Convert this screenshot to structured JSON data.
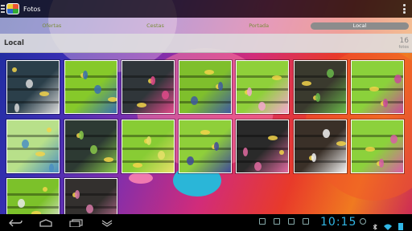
{
  "actionbar": {
    "title": "Fotos",
    "app_icon": "gallery-icon",
    "overflow_icon": "overflow-menu-icon"
  },
  "tabs": [
    {
      "label": "Ofertas",
      "active": false
    },
    {
      "label": "Cestas",
      "active": false
    },
    {
      "label": "Portada",
      "active": false
    },
    {
      "label": "Local",
      "active": true
    }
  ],
  "album": {
    "title": "Local",
    "count": "16",
    "count_label": "fotos"
  },
  "photos": [
    {
      "main": "#2b3f4a",
      "accent": "#d9d9d9"
    },
    {
      "main": "#86c92a",
      "accent": "#3a6fb0"
    },
    {
      "main": "#30363a",
      "accent": "#e04a8a"
    },
    {
      "main": "#7fbf2c",
      "accent": "#3f5aa0"
    },
    {
      "main": "#8fd03a",
      "accent": "#f4a7cf"
    },
    {
      "main": "#3a3a2e",
      "accent": "#6ab84a"
    },
    {
      "main": "#8bd13b",
      "accent": "#c94a9a"
    },
    {
      "main": "#b8e08a",
      "accent": "#4a8ec2"
    },
    {
      "main": "#2d3a33",
      "accent": "#8ac94a"
    },
    {
      "main": "#88cc34",
      "accent": "#e8e06a"
    },
    {
      "main": "#8fcf3a",
      "accent": "#3f4a9a"
    },
    {
      "main": "#2a2a2a",
      "accent": "#e06aa0"
    },
    {
      "main": "#3a3028",
      "accent": "#f2f2f2"
    },
    {
      "main": "#8cd13c",
      "accent": "#d85ea6"
    },
    {
      "main": "#7cc12a",
      "accent": "#eaeaea"
    },
    {
      "main": "#33302e",
      "accent": "#d87aa8"
    }
  ],
  "statusbar": {
    "time": "10:15",
    "accent": "#31b7e6"
  },
  "colors": {
    "tab_text": "#7a8c3a",
    "tab_active_bg": "#8c8c8c"
  }
}
